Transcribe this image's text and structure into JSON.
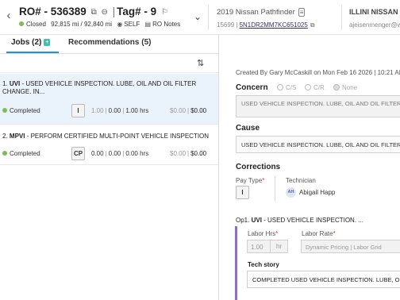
{
  "header": {
    "ro_number": "RO# - 536389",
    "tag": "Tag# - 9",
    "status": "Closed",
    "mileage": "92,815 mi / 92,840 mi",
    "customer_type": "SELF",
    "ro_notes": "RO Notes",
    "vehicle": "2019 Nissan Pathfinder",
    "stock": "15699",
    "vin": "5N1DR2MM7KC651025",
    "dealer": "ILLINI NISSAN",
    "email": "ajeisenmenger@w"
  },
  "tabs": [
    {
      "label": "Jobs (2)",
      "badge": "+"
    },
    {
      "label": "Recommendations (5)"
    }
  ],
  "jobs": [
    {
      "prefix": "1.",
      "code": "UVI",
      "description": " - USED VEHICLE INSPECTION. LUBE, OIL AND OIL FILTER CHANGE. IN...",
      "status": "Completed",
      "pay_type": "I",
      "v1": "1.00",
      "v2": "0.00",
      "hours": "1.00 hrs",
      "m1": "$0.00",
      "m2": "$0.00"
    },
    {
      "prefix": "2.",
      "code": "MPVI",
      "description": " - PERFORM CERTIFIED MULTI-POINT VEHICLE INSPECTION",
      "status": "Completed",
      "pay_type": "CP",
      "v1": "0.00",
      "v2": "0.00",
      "hours": "0.00 hrs",
      "m1": "$0.00",
      "m2": "$0.00"
    }
  ],
  "detail": {
    "created": "Created By Gary McCaskill on Mon Feb 16 2026 | 10:21 AM",
    "concern_label": "Concern",
    "concern_options": [
      "C/S",
      "C/R",
      "None"
    ],
    "concern_text": "USED VEHICLE INSPECTION. LUBE, OIL AND OIL FILTER",
    "cause_label": "Cause",
    "cause_text": "USED VEHICLE INSPECTION. LUBE, OIL AND OIL FILTER C",
    "corrections_label": "Corrections",
    "pay_type_label": "Pay Type",
    "pay_type_value": "I",
    "technician_label": "Technician",
    "technician_initials": "AH",
    "technician_name": "Abigail Happ",
    "op_prefix": "Op1.",
    "op_code": "UVI",
    "op_description": " - USED VEHICLE INSPECTION. ...",
    "labor_hrs_label": "Labor Hrs",
    "labor_hrs_value": "1.00",
    "labor_hrs_unit": "hr",
    "labor_rate_label": "Labor Rate",
    "labor_rate_value": "Dynamic Pricing | Labor Grid",
    "tech_story_label": "Tech story",
    "tech_story_text": "COMPLETED USED VEHICLE INSPECTION. LUBE, OI"
  },
  "colors": {
    "accent": "#1f8fe0",
    "completed": "#7bbf52",
    "op_bar": "#8a6fc4",
    "selected_row": "#eaf3fc"
  }
}
